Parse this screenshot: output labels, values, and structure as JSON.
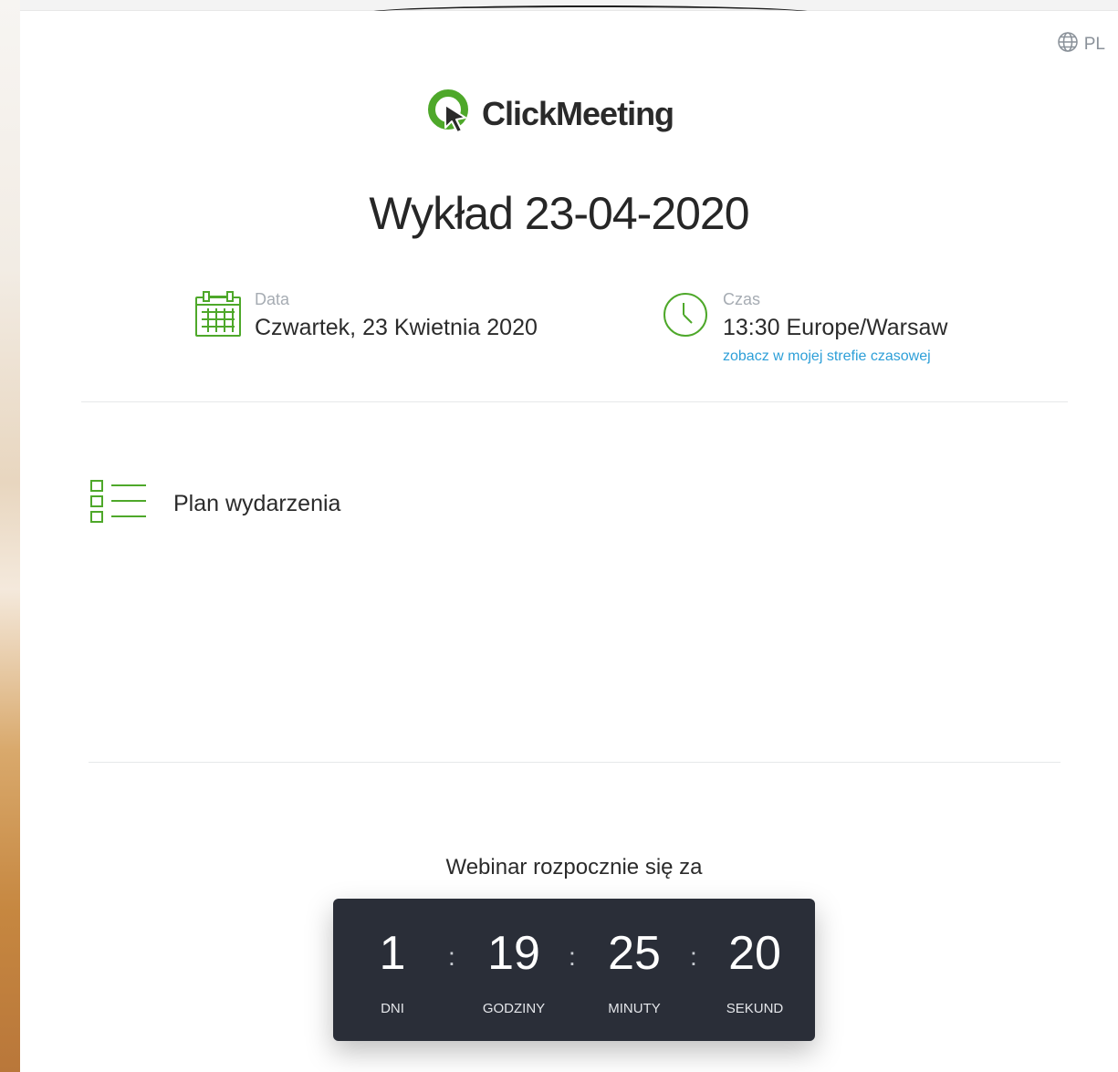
{
  "language": {
    "code": "PL",
    "icon": "globe-icon"
  },
  "logo": {
    "text": "ClickMeeting",
    "brand_color": "#4ea82a"
  },
  "event": {
    "title": "Wykład 23-04-2020"
  },
  "date_info": {
    "label": "Data",
    "value": "Czwartek, 23 Kwietnia 2020",
    "icon": "calendar-icon"
  },
  "time_info": {
    "label": "Czas",
    "value": "13:30 Europe/Warsaw",
    "link": "zobacz w mojej strefie czasowej",
    "icon": "clock-icon"
  },
  "agenda": {
    "label": "Plan wydarzenia",
    "icon": "agenda-list-icon"
  },
  "countdown": {
    "title": "Webinar rozpocznie się za",
    "separator": ":",
    "days": {
      "value": "1",
      "label": "DNI"
    },
    "hours": {
      "value": "19",
      "label": "GODZINY"
    },
    "minutes": {
      "value": "25",
      "label": "MINUTY"
    },
    "seconds": {
      "value": "20",
      "label": "SEKUND"
    }
  },
  "colors": {
    "accent_green": "#4ea82a",
    "link_blue": "#2d9fd8",
    "countdown_bg": "#2a2e38"
  }
}
